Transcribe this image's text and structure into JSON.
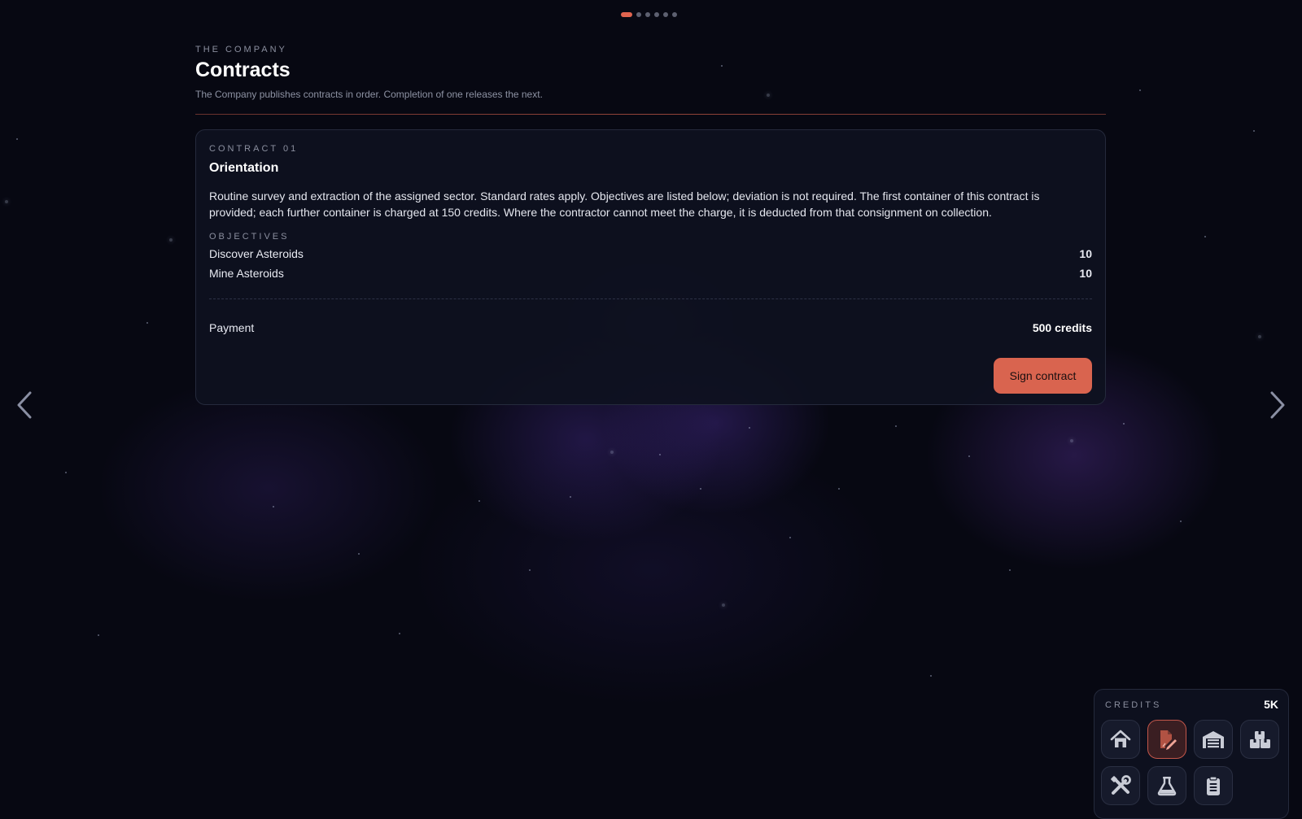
{
  "pager": {
    "count": 6,
    "active_index": 0
  },
  "header": {
    "eyebrow": "THE COMPANY",
    "title": "Contracts",
    "subtitle": "The Company publishes contracts in order. Completion of one releases the next."
  },
  "contract": {
    "number_label": "CONTRACT 01",
    "title": "Orientation",
    "description": "Routine survey and extraction of the assigned sector. Standard rates apply. Objectives are listed below; deviation is not required. The first container of this contract is provided; each further container is charged at 150 credits. Where the contractor cannot meet the charge, it is deducted from that consignment on collection.",
    "objectives_label": "OBJECTIVES",
    "objectives": [
      {
        "name": "Discover Asteroids",
        "value": "10"
      },
      {
        "name": "Mine Asteroids",
        "value": "10"
      }
    ],
    "payment_label": "Payment",
    "payment_value": "500 credits",
    "sign_label": "Sign contract"
  },
  "dock": {
    "credits_label": "CREDITS",
    "credits_value": "5K",
    "buttons": [
      {
        "icon": "home-icon",
        "active": false
      },
      {
        "icon": "contract-sign-icon",
        "active": true
      },
      {
        "icon": "hangar-icon",
        "active": false
      },
      {
        "icon": "cargo-icon",
        "active": false
      },
      {
        "icon": "tools-icon",
        "active": false
      },
      {
        "icon": "flask-icon",
        "active": false
      },
      {
        "icon": "clipboard-icon",
        "active": false
      }
    ]
  },
  "colors": {
    "accent": "#d9644f",
    "background": "#070812",
    "card": "#0e1120"
  }
}
